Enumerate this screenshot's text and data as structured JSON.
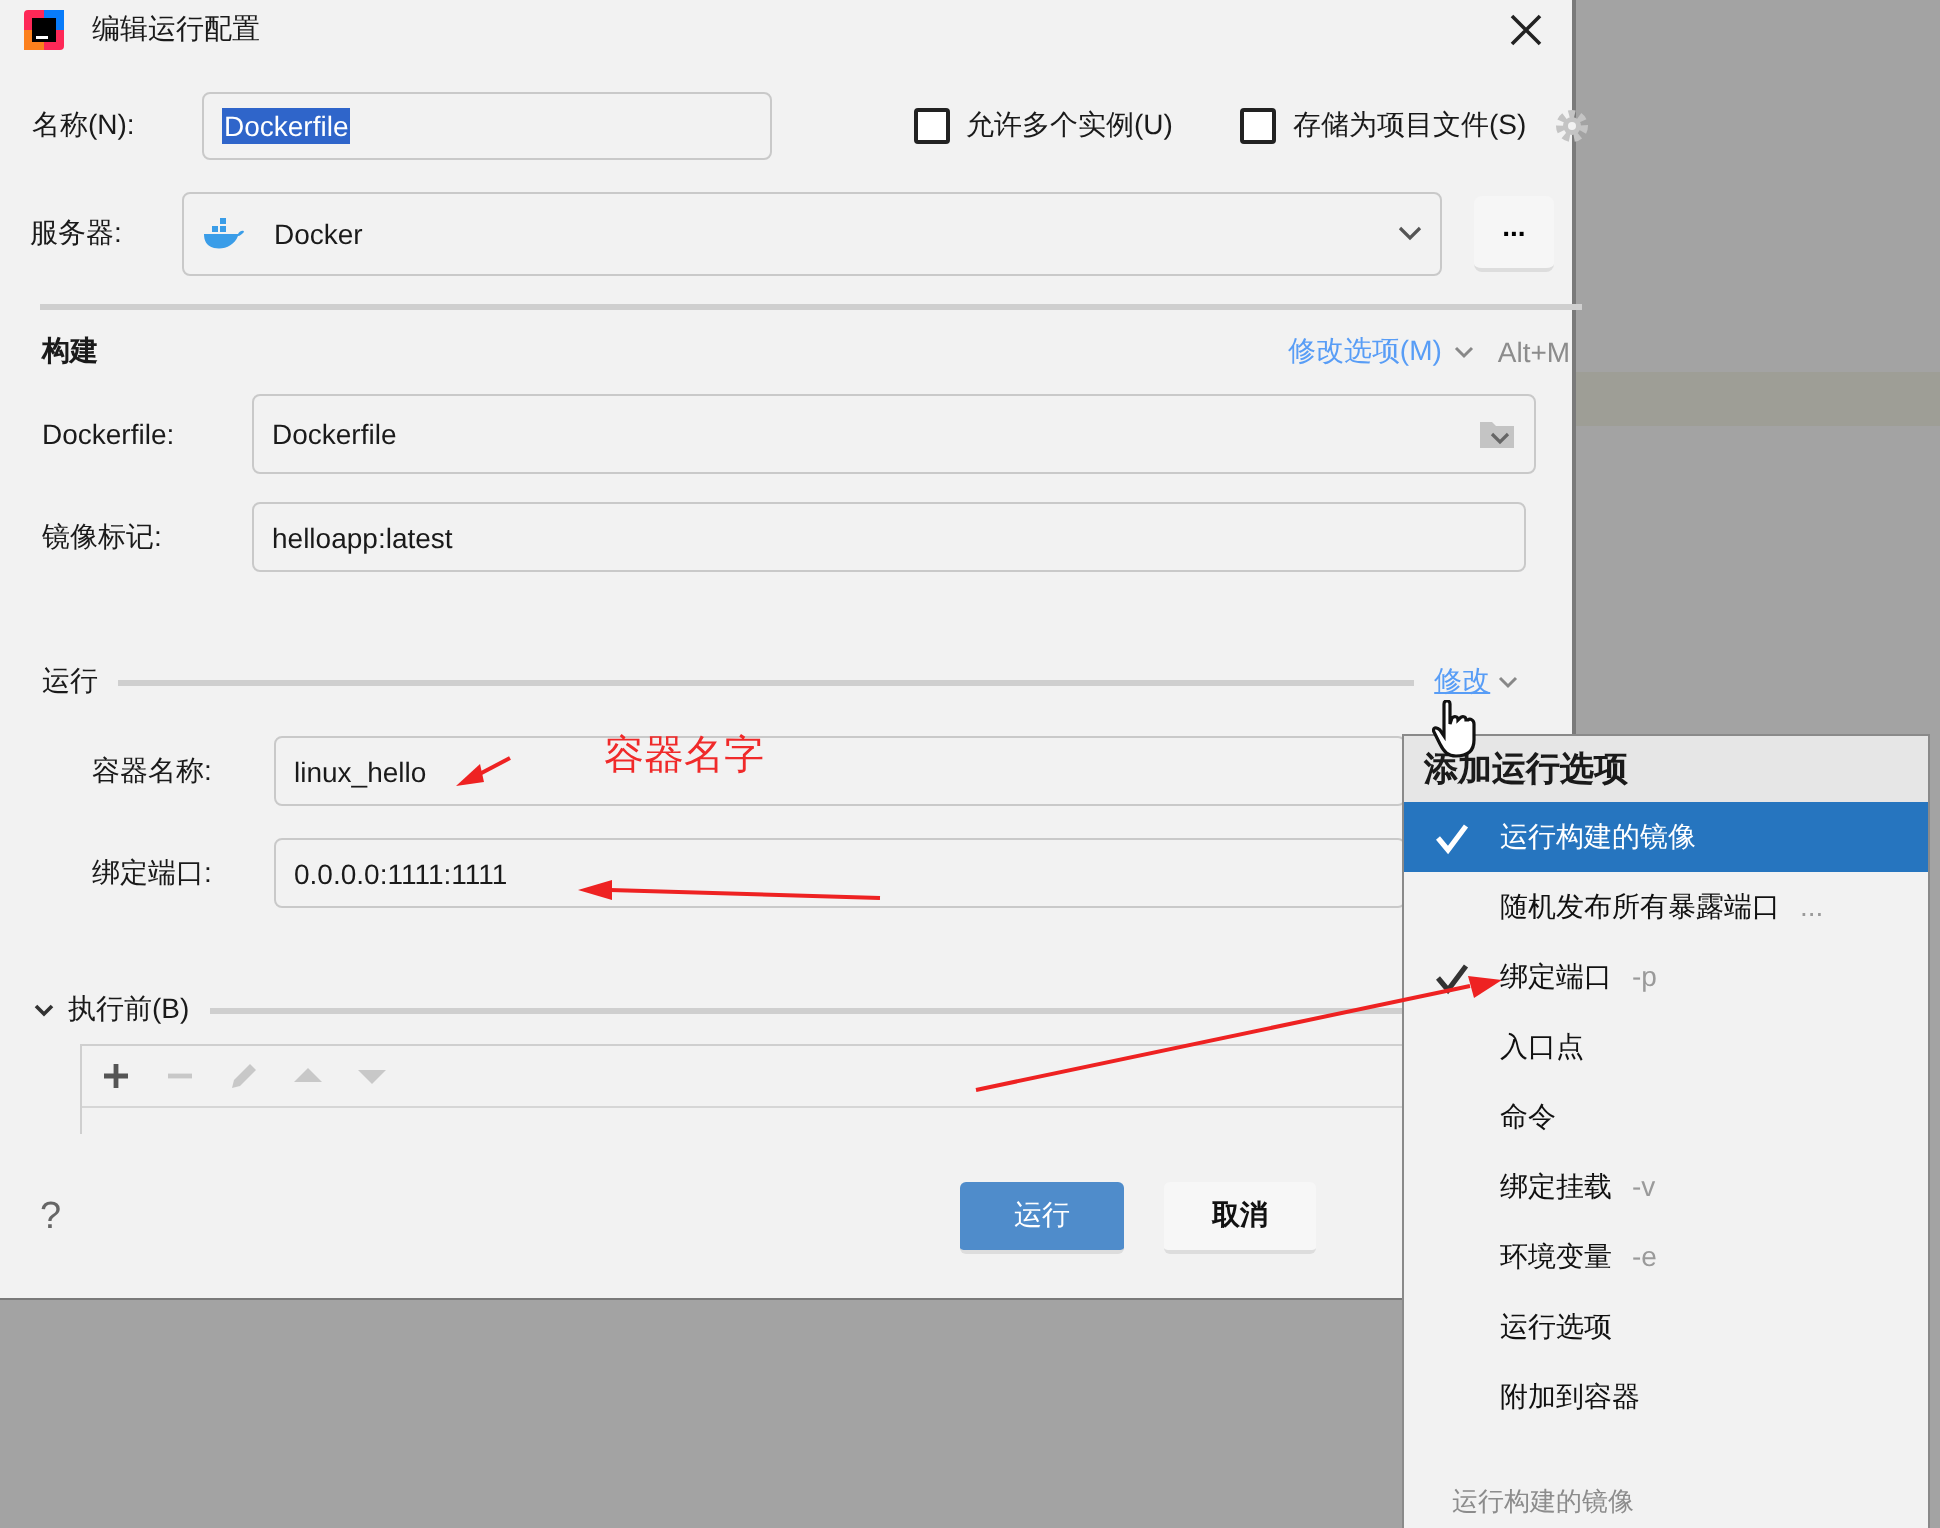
{
  "window": {
    "title": "编辑运行配置"
  },
  "name_row": {
    "label": "名称(N):",
    "value": "Dockerfile",
    "value_selected": true
  },
  "options": [
    {
      "label": "允许多个实例(U)",
      "checked": false
    },
    {
      "label": "存储为项目文件(S)",
      "checked": false
    }
  ],
  "server": {
    "label": "服务器:",
    "value": "Docker",
    "more_button": "..."
  },
  "build_section": {
    "title": "构建",
    "modify_link": "修改选项(M)",
    "shortcut": "Alt+M",
    "fields": [
      {
        "label": "Dockerfile:",
        "value": "Dockerfile",
        "kind": "browse"
      },
      {
        "label": "镜像标记:",
        "value": "helloapp:latest",
        "kind": "text"
      }
    ]
  },
  "run_section": {
    "title": "运行",
    "modify_link": "修改",
    "fields": [
      {
        "label": "容器名称:",
        "value": "linux_hello"
      },
      {
        "label": "绑定端口:",
        "value": "0.0.0.0:1111:1111"
      }
    ]
  },
  "before_launch": {
    "title": "执行前(B)",
    "expanded": true,
    "tools": [
      {
        "kind": "add",
        "disabled": false
      },
      {
        "kind": "remove",
        "disabled": true
      },
      {
        "kind": "edit",
        "disabled": true
      },
      {
        "kind": "up",
        "disabled": true
      },
      {
        "kind": "down",
        "disabled": true
      }
    ]
  },
  "footer": {
    "help": "?",
    "buttons": [
      {
        "label": "运行",
        "kind": "primary"
      },
      {
        "label": "取消",
        "kind": "default"
      }
    ]
  },
  "popup": {
    "title": "添加运行选项",
    "items": [
      {
        "label": "运行构建的镜像",
        "checked": true,
        "selected": true
      },
      {
        "label": "随机发布所有暴露端口",
        "hint": "...",
        "checked": false,
        "selected": false
      },
      {
        "label": "绑定端口",
        "hint": "-p",
        "checked": true,
        "selected": false
      },
      {
        "label": "入口点",
        "checked": false,
        "selected": false
      },
      {
        "label": "命令",
        "checked": false,
        "selected": false
      },
      {
        "label": "绑定挂载",
        "hint": "-v",
        "checked": false,
        "selected": false
      },
      {
        "label": "环境变量",
        "hint": "-e",
        "checked": false,
        "selected": false
      },
      {
        "label": "运行选项",
        "checked": false,
        "selected": false
      },
      {
        "label": "附加到容器",
        "checked": false,
        "selected": false
      }
    ],
    "footer": "运行构建的镜像"
  },
  "annotations": [
    {
      "text": "容器名字"
    }
  ]
}
